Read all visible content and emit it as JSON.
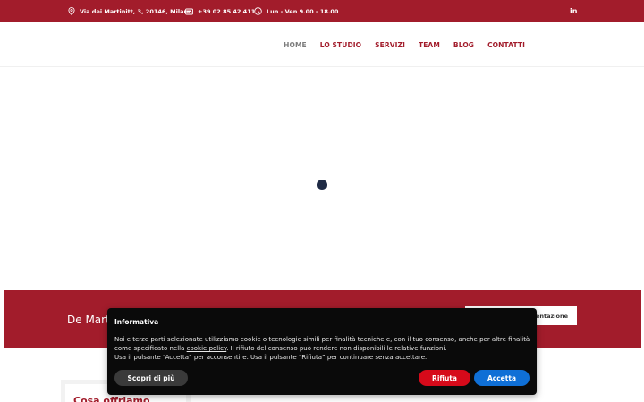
{
  "topbar": {
    "address": "Via dei Martinitt, 3, 20146, Milano",
    "phone": "+39 02 85 42 411",
    "hours": "Lun - Ven 9.00 - 18.00",
    "social": "in"
  },
  "nav": {
    "items": [
      {
        "label": "HOME"
      },
      {
        "label": "LO STUDIO"
      },
      {
        "label": "SERVIZI"
      },
      {
        "label": "TEAM"
      },
      {
        "label": "BLOG"
      },
      {
        "label": "CONTATTI"
      }
    ]
  },
  "band": {
    "title": "De Marti",
    "button": "sentazione"
  },
  "card": {
    "title": "Cosa offriamo"
  },
  "cookie": {
    "title": "Informativa",
    "text_1": "Noi e terze parti selezionate utilizziamo cookie o tecnologie simili per finalità tecniche e, con il tuo consenso, anche per altre finalità come specificato nella ",
    "link": "cookie policy",
    "text_2": ". Il rifiuto del consenso può rendere non disponibili le relative funzioni.",
    "text_3": "Usa il pulsante “Accetta” per acconsentire. Usa il pulsante “Rifiuta” per continuare senza accettare.",
    "more_label": "Scopri di più",
    "reject_label": "Rifiuta",
    "accept_label": "Accetta"
  },
  "colors": {
    "brand_red": "#a21c2b",
    "loader": "#1f2b45",
    "reject": "#d60a1a",
    "accept": "#0f6fd6"
  }
}
